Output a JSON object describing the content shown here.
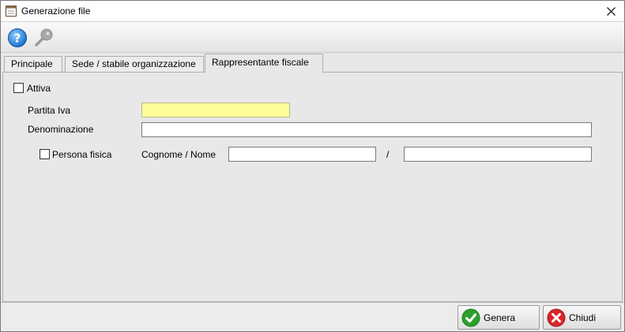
{
  "window": {
    "title": "Generazione file"
  },
  "toolbar": {
    "help_icon": "help-icon",
    "key_icon": "key-icon"
  },
  "tabs": [
    {
      "label": "Principale"
    },
    {
      "label": "Sede / stabile organizzazione"
    },
    {
      "label": "Rappresentante fiscale"
    }
  ],
  "form": {
    "attiva_label": "Attiva",
    "partita_iva_label": "Partita Iva",
    "partita_iva_value": "",
    "denominazione_label": "Denominazione",
    "denominazione_value": "",
    "persona_fisica_label": "Persona fisica",
    "cognome_nome_label": "Cognome / Nome",
    "cognome_value": "",
    "separator": "/",
    "nome_value": ""
  },
  "buttons": {
    "genera": "Genera",
    "chiudi": "Chiudi"
  },
  "colors": {
    "required_field": "#ffff99",
    "ok_green": "#2ca02c",
    "cancel_red": "#d9262a"
  }
}
